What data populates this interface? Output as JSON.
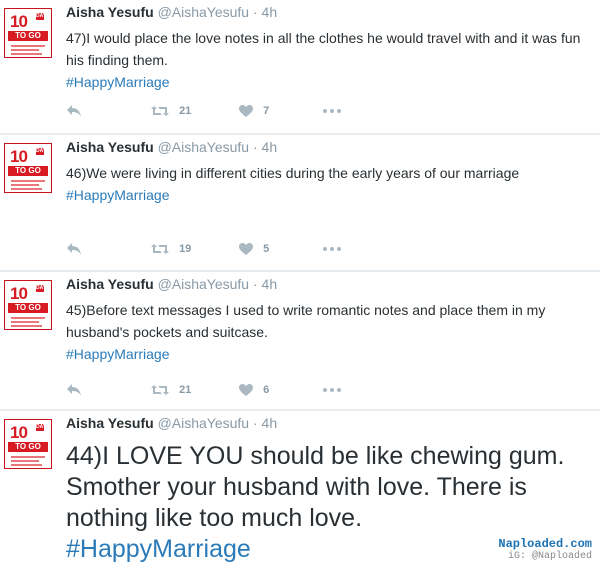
{
  "tweets": [
    {
      "name": "Aisha Yesufu",
      "handle": "@AishaYesufu",
      "time": "· 4h",
      "text": "47)I would place the love notes in all the clothes he would travel with and it was fun his finding them.",
      "hashtag": "#HappyMarriage",
      "retweets": "21",
      "likes": "7"
    },
    {
      "name": "Aisha Yesufu",
      "handle": "@AishaYesufu",
      "time": "· 4h",
      "text": "46)We were living in different cities during the early years of our marriage",
      "hashtag": "#HappyMarriage",
      "retweets": "19",
      "likes": "5"
    },
    {
      "name": "Aisha Yesufu",
      "handle": "@AishaYesufu",
      "time": "· 4h",
      "text": "45)Before text messages I used to write romantic notes and place them in my husband's pockets and suitcase.",
      "hashtag": "#HappyMarriage",
      "retweets": "21",
      "likes": "6"
    },
    {
      "name": "Aisha Yesufu",
      "handle": "@AishaYesufu",
      "time": "· 4h",
      "text": "44)I LOVE YOU should be like chewing gum. Smother your husband with love. There is nothing like too much love.",
      "hashtag": "#HappyMarriage"
    }
  ],
  "avatar": {
    "number": "10",
    "days": "DAYS",
    "to_go": "TO GO"
  },
  "icons": [
    "reply-icon",
    "retweet-icon",
    "heart-icon",
    "more-icon"
  ],
  "watermark": {
    "line1": "Naploaded.com",
    "line2": "iG: @Naploaded"
  },
  "colors": {
    "hashtag": "#2b7bb9",
    "meta": "#8899a6",
    "icon": "#aab8c2",
    "avatar_red": "#d81a23"
  }
}
